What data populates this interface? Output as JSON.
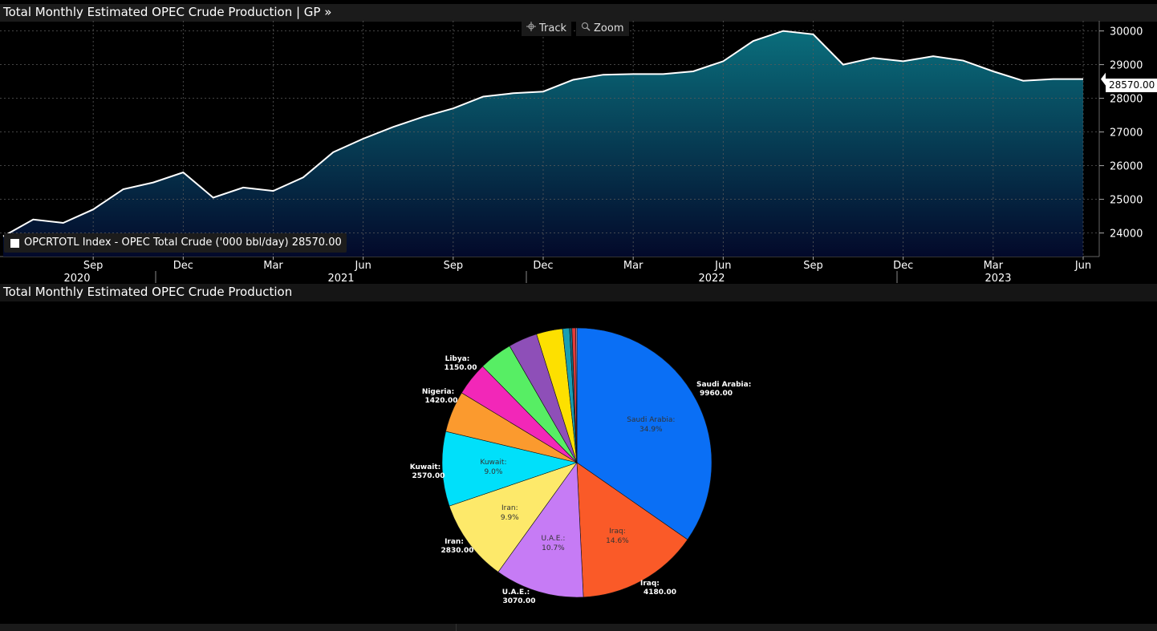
{
  "headers": {
    "line_title": "Total Monthly Estimated OPEC Crude Production | GP »",
    "pie_title": "Total Monthly Estimated OPEC Crude Production"
  },
  "toolbar": {
    "track_label": "Track",
    "zoom_label": "Zoom",
    "track_icon": "crosshair-icon",
    "zoom_icon": "magnifier-icon"
  },
  "colors": {
    "line": "#ffffff",
    "area_top": "#0a6e7c",
    "area_bottom": "#03092a",
    "grid": "#5a5a5a",
    "badge_bg": "#ffffff"
  },
  "chart_data": [
    {
      "type": "area",
      "title": "Total Monthly Estimated OPEC Crude Production | GP »",
      "series": [
        {
          "name": "OPCRTOTL Index - OPEC Total Crude ('000 bbl/day) 28570.00",
          "x": [
            "2020-06",
            "2020-07",
            "2020-08",
            "2020-09",
            "2020-10",
            "2020-11",
            "2020-12",
            "2021-01",
            "2021-02",
            "2021-03",
            "2021-04",
            "2021-05",
            "2021-06",
            "2021-07",
            "2021-08",
            "2021-09",
            "2021-10",
            "2021-11",
            "2021-12",
            "2022-01",
            "2022-02",
            "2022-03",
            "2022-04",
            "2022-05",
            "2022-06",
            "2022-07",
            "2022-08",
            "2022-09",
            "2022-10",
            "2022-11",
            "2022-12",
            "2023-01",
            "2023-02",
            "2023-03",
            "2023-04",
            "2023-05",
            "2023-06"
          ],
          "values": [
            23900,
            24400,
            24300,
            24700,
            25300,
            25500,
            25800,
            25050,
            25350,
            25250,
            25650,
            26400,
            26800,
            27150,
            27450,
            27700,
            28050,
            28150,
            28200,
            28550,
            28700,
            28720,
            28720,
            28800,
            29100,
            29700,
            30000,
            29900,
            29000,
            29200,
            29100,
            29250,
            29120,
            28800,
            28520,
            28570,
            28570
          ]
        }
      ],
      "y_ticks": [
        24000,
        25000,
        26000,
        27000,
        28000,
        29000,
        30000
      ],
      "ylim": [
        23300,
        30300
      ],
      "x_tick_labels": [
        {
          "month": "2020-09",
          "label": "Sep"
        },
        {
          "month": "2020-12",
          "label": "Dec"
        },
        {
          "month": "2021-03",
          "label": "Mar"
        },
        {
          "month": "2021-06",
          "label": "Jun"
        },
        {
          "month": "2021-09",
          "label": "Sep"
        },
        {
          "month": "2021-12",
          "label": "Dec"
        },
        {
          "month": "2022-03",
          "label": "Mar"
        },
        {
          "month": "2022-06",
          "label": "Jun"
        },
        {
          "month": "2022-09",
          "label": "Sep"
        },
        {
          "month": "2022-12",
          "label": "Dec"
        },
        {
          "month": "2023-03",
          "label": "Mar"
        },
        {
          "month": "2023-06",
          "label": "Jun"
        }
      ],
      "year_labels": [
        "2020",
        "2021",
        "2022",
        "2023"
      ],
      "last_value_label": "28570.00",
      "legend": "OPCRTOTL Index - OPEC Total Crude ('000 bbl/day) 28570.00",
      "grid": true
    },
    {
      "type": "pie",
      "title": "Total Monthly Estimated OPEC Crude Production",
      "slices": [
        {
          "name": "Saudi Arabia",
          "value": 9960.0,
          "value_label": "9960.00",
          "pct_label": "34.9%",
          "color": "#0a6ff5"
        },
        {
          "name": "Iraq",
          "value": 4180.0,
          "value_label": "4180.00",
          "pct_label": "14.6%",
          "color": "#fa5a28"
        },
        {
          "name": "U.A.E.",
          "value": 3070.0,
          "value_label": "3070.00",
          "pct_label": "10.7%",
          "color": "#c67bf5"
        },
        {
          "name": "Iran",
          "value": 2830.0,
          "value_label": "2830.00",
          "pct_label": "9.9%",
          "color": "#fde96a"
        },
        {
          "name": "Kuwait",
          "value": 2570.0,
          "value_label": "2570.00",
          "pct_label": "9.0%",
          "color": "#00e0fa"
        },
        {
          "name": "Nigeria",
          "value": 1420.0,
          "value_label": "1420.00",
          "color": "#fb9a2e"
        },
        {
          "name": "Libya",
          "value": 1150.0,
          "value_label": "1150.00",
          "color": "#f227b8"
        },
        {
          "name": "",
          "value": 1150,
          "color": "#57ee64"
        },
        {
          "name": "",
          "value": 1000,
          "color": "#8e4fb8"
        },
        {
          "name": "",
          "value": 900,
          "color": "#fde000"
        },
        {
          "name": "",
          "value": 240,
          "color": "#1a9fb3"
        },
        {
          "name": "",
          "value": 80,
          "color": "#0f6e85"
        },
        {
          "name": "",
          "value": 130,
          "color": "#e33a3a"
        },
        {
          "name": "",
          "value": 40,
          "color": "#f0a0b8"
        }
      ]
    }
  ]
}
